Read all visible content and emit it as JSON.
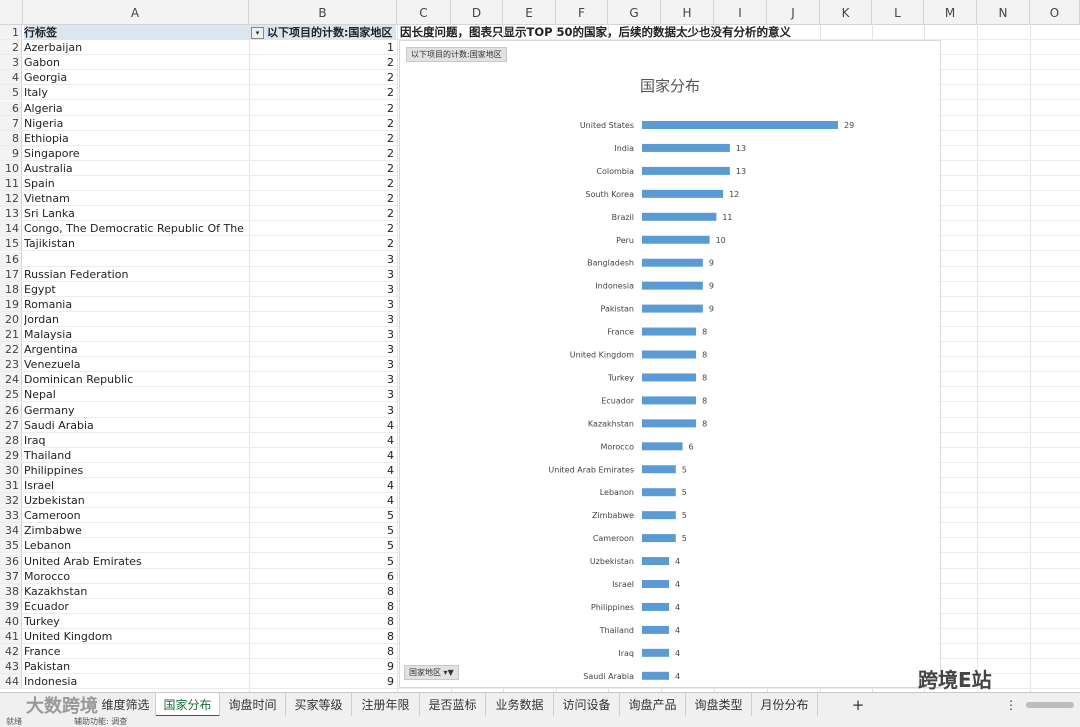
{
  "columns": [
    "A",
    "B",
    "C",
    "D",
    "E",
    "F",
    "G",
    "H",
    "I",
    "J",
    "K",
    "L",
    "M",
    "N",
    "O"
  ],
  "header_row": {
    "row_label": "行标签",
    "count_label": "以下项目的计数:国家地区"
  },
  "note": "因长度问题，图表只显示TOP 50的国家，后续的数据太少也没有分析的意义",
  "rows": [
    {
      "n": "2",
      "name": "Azerbaijan",
      "v": "1"
    },
    {
      "n": "3",
      "name": "Gabon",
      "v": "2"
    },
    {
      "n": "4",
      "name": "Georgia",
      "v": "2"
    },
    {
      "n": "5",
      "name": "Italy",
      "v": "2"
    },
    {
      "n": "6",
      "name": "Algeria",
      "v": "2"
    },
    {
      "n": "7",
      "name": "Nigeria",
      "v": "2"
    },
    {
      "n": "8",
      "name": "Ethiopia",
      "v": "2"
    },
    {
      "n": "9",
      "name": "Singapore",
      "v": "2"
    },
    {
      "n": "10",
      "name": "Australia",
      "v": "2"
    },
    {
      "n": "11",
      "name": "Spain",
      "v": "2"
    },
    {
      "n": "12",
      "name": "Vietnam",
      "v": "2"
    },
    {
      "n": "13",
      "name": "Sri Lanka",
      "v": "2"
    },
    {
      "n": "14",
      "name": "Congo, The Democratic Republic Of The",
      "v": "2"
    },
    {
      "n": "15",
      "name": "Tajikistan",
      "v": "2"
    },
    {
      "n": "16",
      "name": "",
      "v": "3"
    },
    {
      "n": "17",
      "name": "Russian Federation",
      "v": "3"
    },
    {
      "n": "18",
      "name": "Egypt",
      "v": "3"
    },
    {
      "n": "19",
      "name": "Romania",
      "v": "3"
    },
    {
      "n": "20",
      "name": "Jordan",
      "v": "3"
    },
    {
      "n": "21",
      "name": "Malaysia",
      "v": "3"
    },
    {
      "n": "22",
      "name": "Argentina",
      "v": "3"
    },
    {
      "n": "23",
      "name": "Venezuela",
      "v": "3"
    },
    {
      "n": "24",
      "name": "Dominican Republic",
      "v": "3"
    },
    {
      "n": "25",
      "name": "Nepal",
      "v": "3"
    },
    {
      "n": "26",
      "name": "Germany",
      "v": "3"
    },
    {
      "n": "27",
      "name": "Saudi Arabia",
      "v": "4"
    },
    {
      "n": "28",
      "name": "Iraq",
      "v": "4"
    },
    {
      "n": "29",
      "name": "Thailand",
      "v": "4"
    },
    {
      "n": "30",
      "name": "Philippines",
      "v": "4"
    },
    {
      "n": "31",
      "name": "Israel",
      "v": "4"
    },
    {
      "n": "32",
      "name": "Uzbekistan",
      "v": "4"
    },
    {
      "n": "33",
      "name": "Cameroon",
      "v": "5"
    },
    {
      "n": "34",
      "name": "Zimbabwe",
      "v": "5"
    },
    {
      "n": "35",
      "name": "Lebanon",
      "v": "5"
    },
    {
      "n": "36",
      "name": "United Arab Emirates",
      "v": "5"
    },
    {
      "n": "37",
      "name": "Morocco",
      "v": "6"
    },
    {
      "n": "38",
      "name": "Kazakhstan",
      "v": "8"
    },
    {
      "n": "39",
      "name": "Ecuador",
      "v": "8"
    },
    {
      "n": "40",
      "name": "Turkey",
      "v": "8"
    },
    {
      "n": "41",
      "name": "United Kingdom",
      "v": "8"
    },
    {
      "n": "42",
      "name": "France",
      "v": "8"
    },
    {
      "n": "43",
      "name": "Pakistan",
      "v": "9"
    },
    {
      "n": "44",
      "name": "Indonesia",
      "v": "9"
    }
  ],
  "chart_field_button": "以下项目的计数:国家地区",
  "chart_axis_button": "国家地区",
  "chart_data": {
    "type": "bar",
    "orientation": "horizontal",
    "title": "国家分布",
    "bar_color": "#5b9bd5",
    "categories": [
      "United States",
      "India",
      "Colombia",
      "South Korea",
      "Brazil",
      "Peru",
      "Bangladesh",
      "Indonesia",
      "Pakistan",
      "France",
      "United Kingdom",
      "Turkey",
      "Ecuador",
      "Kazakhstan",
      "Morocco",
      "United Arab Emirates",
      "Lebanon",
      "Zimbabwe",
      "Cameroon",
      "Uzbekistan",
      "Israel",
      "Philippines",
      "Thailand",
      "Iraq",
      "Saudi Arabia"
    ],
    "values": [
      29,
      13,
      13,
      12,
      11,
      10,
      9,
      9,
      9,
      8,
      8,
      8,
      8,
      8,
      6,
      5,
      5,
      5,
      5,
      4,
      4,
      4,
      4,
      4,
      4
    ],
    "xlim": [
      0,
      30
    ],
    "data_labels": true,
    "grid": false
  },
  "tabs": [
    "维度筛选",
    "国家分布",
    "询盘时间",
    "买家等级",
    "注册年限",
    "是否蓝标",
    "业务数据",
    "访问设备",
    "询盘产品",
    "询盘类型",
    "月份分布"
  ],
  "active_tab": "国家分布",
  "add_sheet_glyph": "+",
  "status_text": "就绪",
  "status_accessibility": "辅助功能: 调查",
  "watermark_left": "大数跨境",
  "watermark_right": "跨境E站"
}
